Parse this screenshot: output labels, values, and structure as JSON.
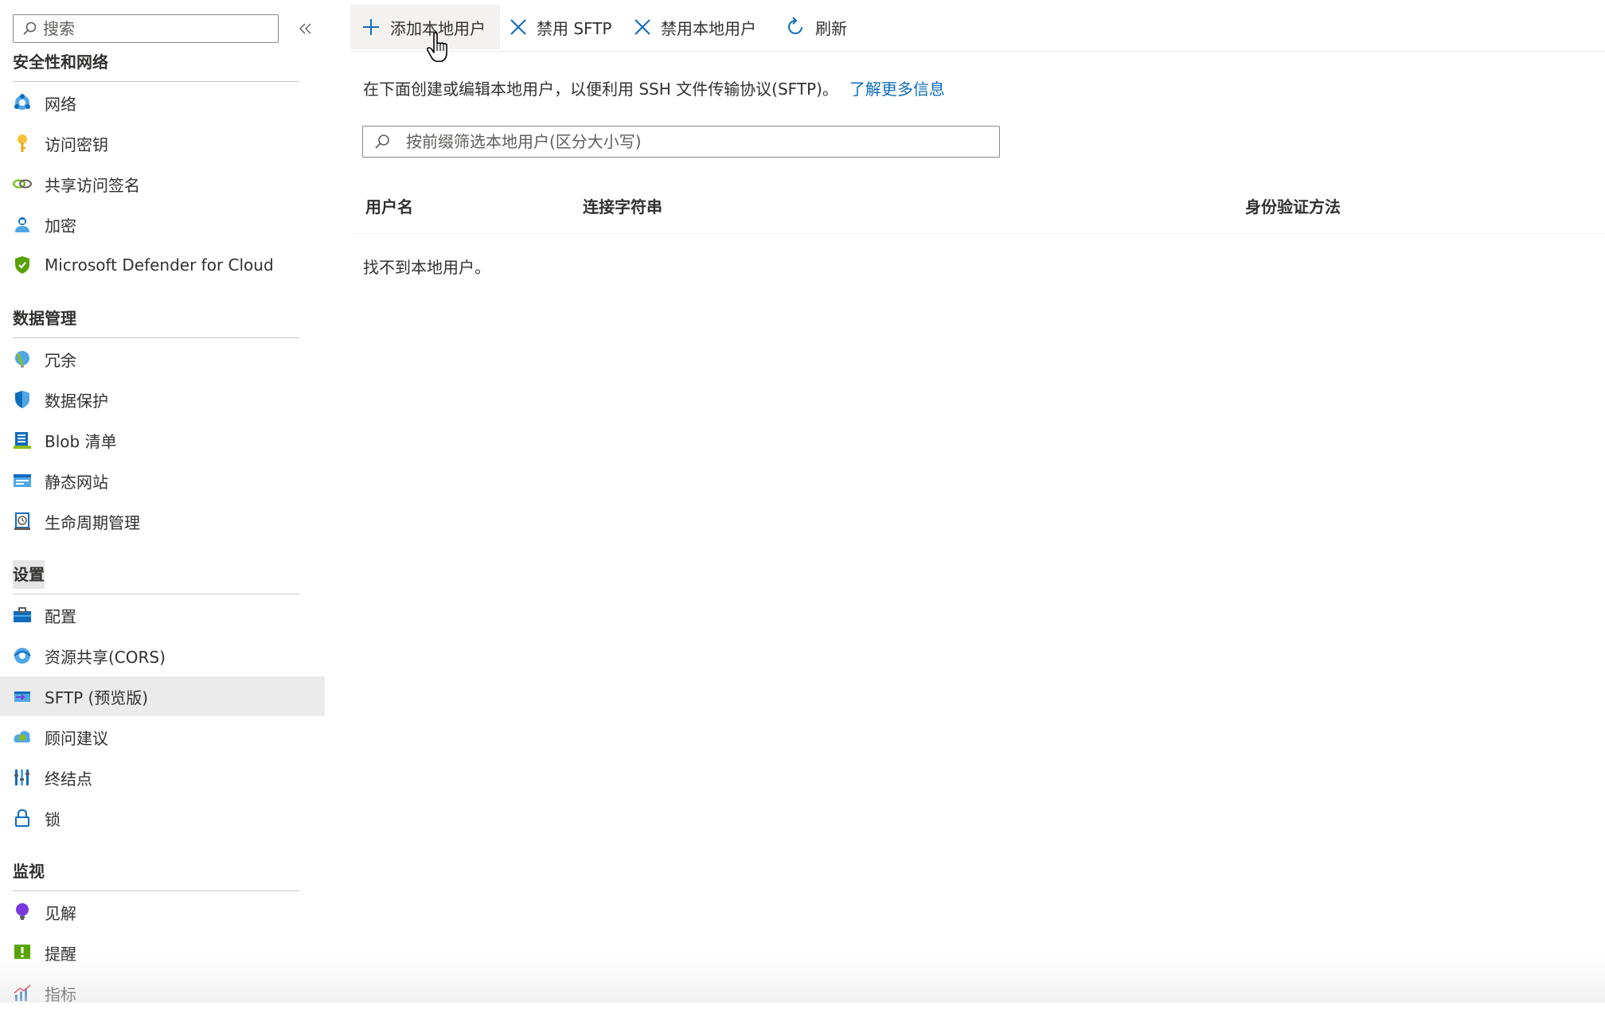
{
  "sidebar": {
    "search_placeholder": "搜索",
    "sections": [
      {
        "title": "安全性和网络",
        "items": [
          {
            "label": "网络",
            "icon": "network-icon"
          },
          {
            "label": "访问密钥",
            "icon": "key-icon"
          },
          {
            "label": "共享访问签名",
            "icon": "link-icon"
          },
          {
            "label": "加密",
            "icon": "lock-person-icon"
          },
          {
            "label": "Microsoft Defender for Cloud",
            "icon": "shield-icon"
          }
        ]
      },
      {
        "title": "数据管理",
        "items": [
          {
            "label": "冗余",
            "icon": "globe-icon"
          },
          {
            "label": "数据保护",
            "icon": "shield-half-icon"
          },
          {
            "label": "Blob 清单",
            "icon": "inventory-icon"
          },
          {
            "label": "静态网站",
            "icon": "website-icon"
          },
          {
            "label": "生命周期管理",
            "icon": "lifecycle-icon"
          }
        ]
      },
      {
        "title": "设置",
        "items": [
          {
            "label": "配置",
            "icon": "toolbox-icon"
          },
          {
            "label": "资源共享(CORS)",
            "icon": "cors-icon"
          },
          {
            "label": "SFTP (预览版)",
            "icon": "sftp-icon",
            "active": true
          },
          {
            "label": "顾问建议",
            "icon": "advisor-icon"
          },
          {
            "label": "终结点",
            "icon": "endpoints-icon"
          },
          {
            "label": "锁",
            "icon": "padlock-icon"
          }
        ]
      },
      {
        "title": "监视",
        "items": [
          {
            "label": "见解",
            "icon": "bulb-icon"
          },
          {
            "label": "提醒",
            "icon": "alert-icon"
          },
          {
            "label": "指标",
            "icon": "metrics-icon"
          }
        ]
      }
    ]
  },
  "toolbar": {
    "add_user": "添加本地用户",
    "disable_sftp": "禁用 SFTP",
    "disable_local_users": "禁用本地用户",
    "refresh": "刷新"
  },
  "main": {
    "intro": "在下面创建或编辑本地用户，以便利用 SSH 文件传输协议(SFTP)。",
    "learn_more": "了解更多信息",
    "filter_placeholder": "按前缀筛选本地用户(区分大小写)",
    "columns": [
      "用户名",
      "连接字符串",
      "身份验证方法"
    ],
    "empty_message": "找不到本地用户。"
  },
  "colors": {
    "accent": "#0f6cbd",
    "active_bg": "#ebebeb"
  }
}
